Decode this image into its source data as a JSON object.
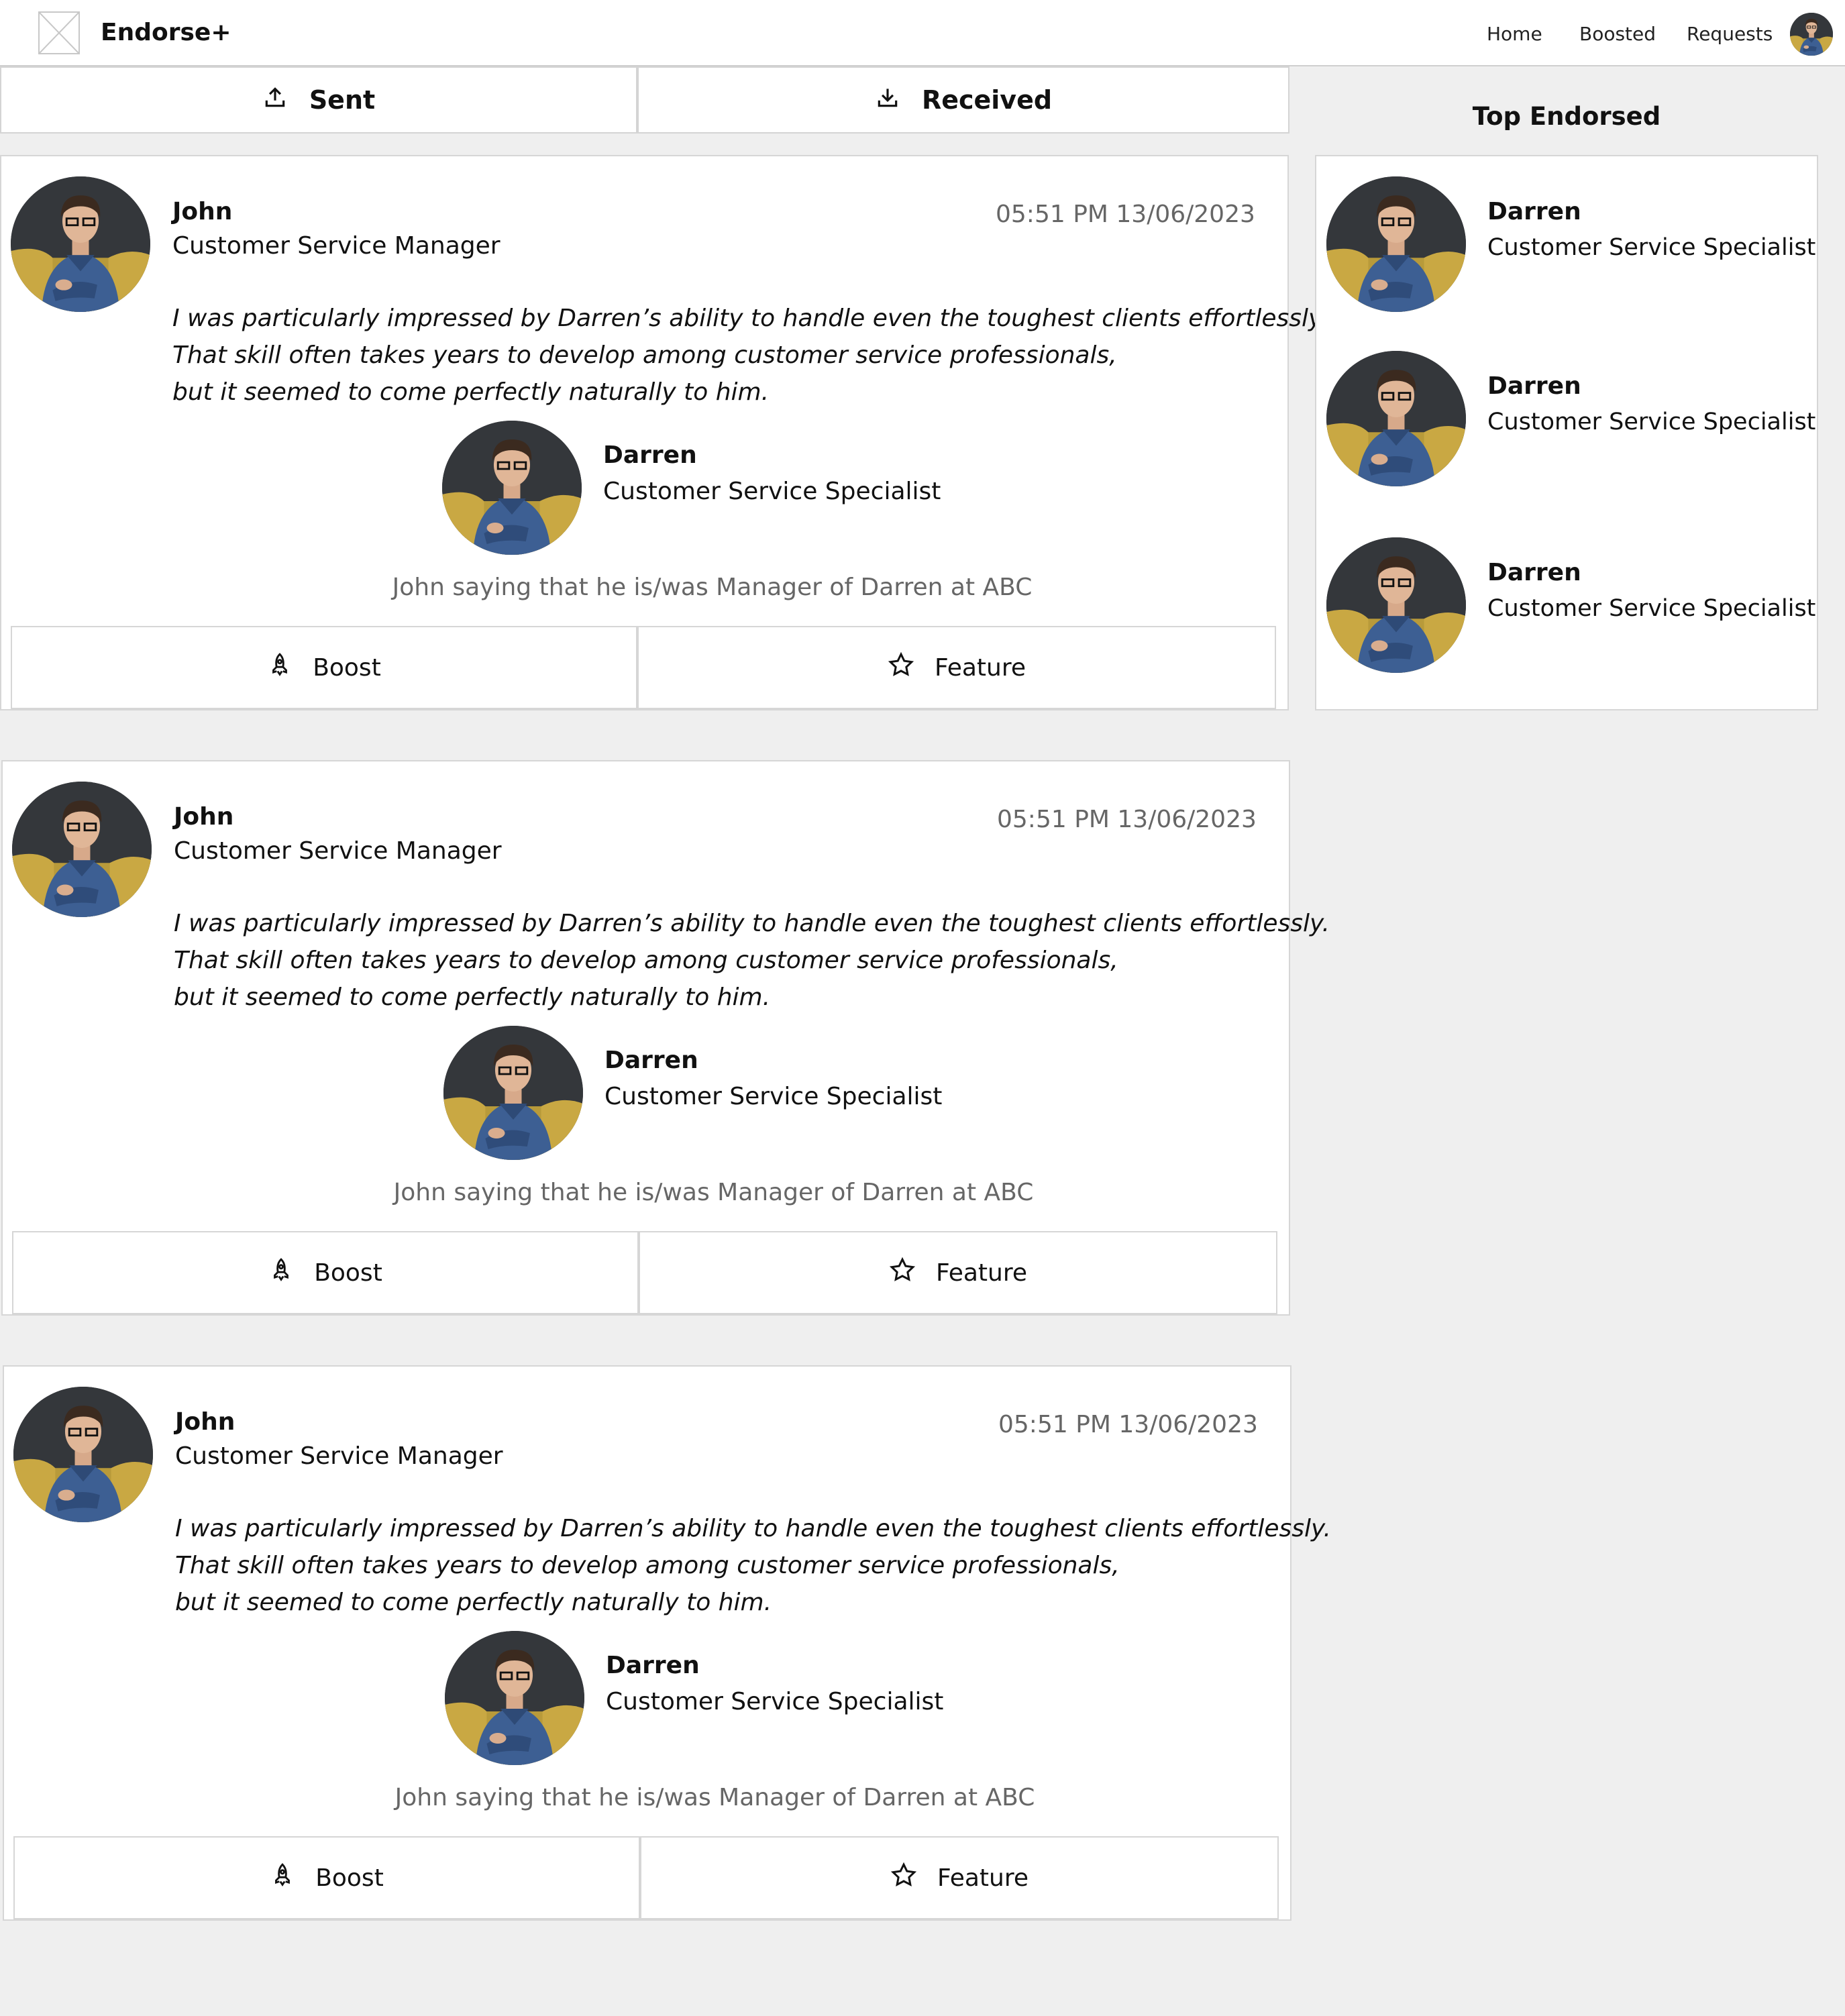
{
  "header": {
    "brand": "Endorse+",
    "nav": [
      {
        "label": "Home"
      },
      {
        "label": "Boosted"
      },
      {
        "label": "Requests"
      }
    ]
  },
  "tabs": {
    "sent": {
      "label": "Sent",
      "icon": "upload-icon"
    },
    "received": {
      "label": "Received",
      "icon": "download-icon"
    }
  },
  "endorsements": [
    {
      "author": {
        "name": "John",
        "role": "Customer Service Manager"
      },
      "timestamp": "05:51 PM 13/06/2023",
      "quote": [
        "I was particularly impressed by Darren’s ability to handle even the toughest clients effortlessly.",
        "That skill often takes years to develop among customer service professionals,",
        "but it seemed to come perfectly naturally to him."
      ],
      "subject": {
        "name": "Darren",
        "role": "Customer Service Specialist"
      },
      "relation": "John saying that he is/was Manager of Darren at ABC",
      "boost_label": "Boost",
      "feature_label": "Feature"
    },
    {
      "author": {
        "name": "John",
        "role": "Customer Service Manager"
      },
      "timestamp": "05:51 PM 13/06/2023",
      "quote": [
        "I was particularly impressed by Darren’s ability to handle even the toughest clients effortlessly.",
        "That skill often takes years to develop among customer service professionals,",
        "but it seemed to come perfectly naturally to him."
      ],
      "subject": {
        "name": "Darren",
        "role": "Customer Service Specialist"
      },
      "relation": "John saying that he is/was Manager of Darren at ABC",
      "boost_label": "Boost",
      "feature_label": "Feature"
    },
    {
      "author": {
        "name": "John",
        "role": "Customer Service Manager"
      },
      "timestamp": "05:51 PM 13/06/2023",
      "quote": [
        "I was particularly impressed by Darren’s ability to handle even the toughest clients effortlessly.",
        "That skill often takes years to develop among customer service professionals,",
        "but it seemed to come perfectly naturally to him."
      ],
      "subject": {
        "name": "Darren",
        "role": "Customer Service Specialist"
      },
      "relation": "John saying that he is/was Manager of Darren at ABC",
      "boost_label": "Boost",
      "feature_label": "Feature"
    }
  ],
  "sidebar": {
    "title": "Top Endorsed",
    "people": [
      {
        "name": "Darren",
        "role": "Customer Service Specialist"
      },
      {
        "name": "Darren",
        "role": "Customer Service Specialist"
      },
      {
        "name": "Darren",
        "role": "Customer Service Specialist"
      }
    ]
  },
  "colors": {
    "background": "#efefef",
    "card": "#ffffff",
    "border": "#d6d6d6",
    "muted_text": "#666666"
  },
  "icons": {
    "boost": "rocket-icon",
    "feature": "star-icon",
    "logo": "image-placeholder-icon"
  }
}
